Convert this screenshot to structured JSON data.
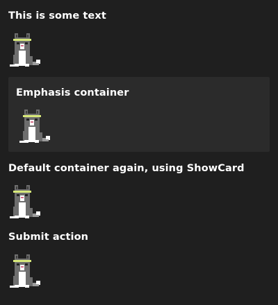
{
  "blocks": {
    "first_text": "This is some text",
    "emphasis_title": "Emphasis container",
    "default_again_text": "Default container again, using ShowCard",
    "submit_text": "Submit action"
  },
  "icons": {
    "cat": "cat-image-icon"
  },
  "colors": {
    "background": "#1f1f1f",
    "emphasis_background": "#2b2b2b",
    "text": "#ffffff",
    "headband": "#d7e87a"
  }
}
